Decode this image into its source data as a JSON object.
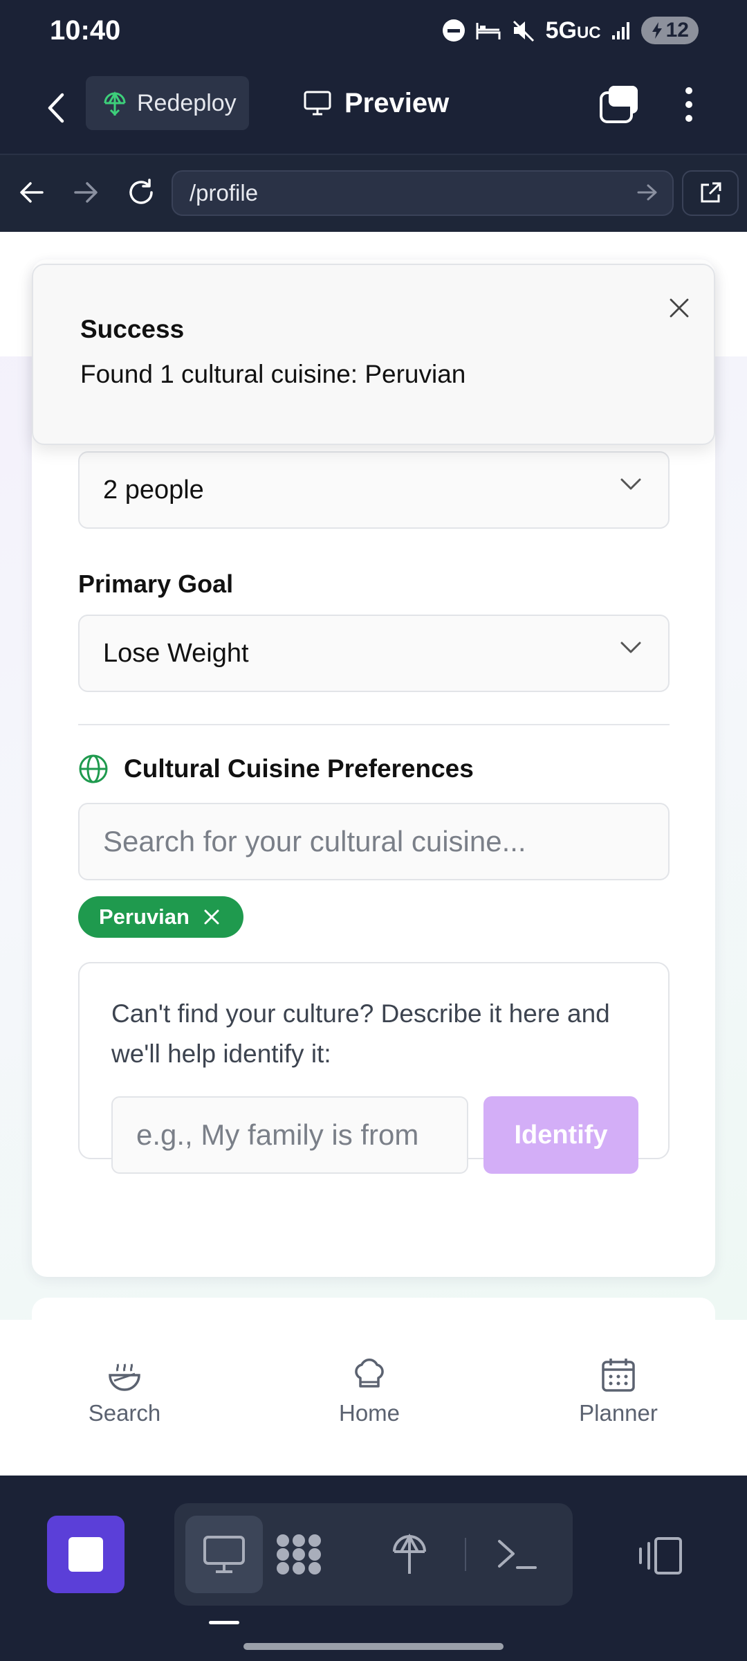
{
  "status_bar": {
    "time": "10:40",
    "network": "5G",
    "network_suffix": "UC",
    "battery": "12",
    "icons": [
      "do-not-disturb-icon",
      "bed-icon",
      "mute-icon",
      "signal-icon",
      "battery-charging-icon"
    ]
  },
  "app_bar": {
    "redeploy_label": "Redeploy",
    "preview_label": "Preview",
    "icons": [
      "back-chevron-icon",
      "redeploy-icon",
      "monitor-icon",
      "tabs-icon",
      "kebab-icon"
    ]
  },
  "browser": {
    "url": "/profile",
    "icons": [
      "back-arrow-icon",
      "forward-arrow-icon",
      "reload-icon",
      "go-arrow-icon",
      "external-link-icon"
    ]
  },
  "toast": {
    "title": "Success",
    "message": "Found 1 cultural cuisine: Peruvian"
  },
  "form": {
    "household_value": "2 people",
    "goal_label": "Primary Goal",
    "goal_value": "Lose Weight",
    "cuisine_heading": "Cultural Cuisine Preferences",
    "cuisine_search_placeholder": "Search for your cultural cuisine...",
    "selected_cuisines": [
      "Peruvian"
    ],
    "help_text": "Can't find your culture? Describe it here and we'll help identify it:",
    "describe_placeholder": "e.g., My family is from",
    "identify_label": "Identify"
  },
  "bottom_nav": [
    {
      "label": "Search",
      "icon": "bowl-icon"
    },
    {
      "label": "Home",
      "icon": "chef-hat-icon"
    },
    {
      "label": "Planner",
      "icon": "calendar-icon"
    }
  ],
  "dock": {
    "icons": [
      "stop-icon",
      "monitor-icon",
      "apps-grid-icon",
      "deploy-icon",
      "terminal-icon",
      "split-view-icon"
    ]
  },
  "colors": {
    "dark_bg": "#1b2236",
    "accent_green": "#1f9a4e",
    "identify_purple": "#d3aef7",
    "stop_purple": "#5b3fd8"
  }
}
